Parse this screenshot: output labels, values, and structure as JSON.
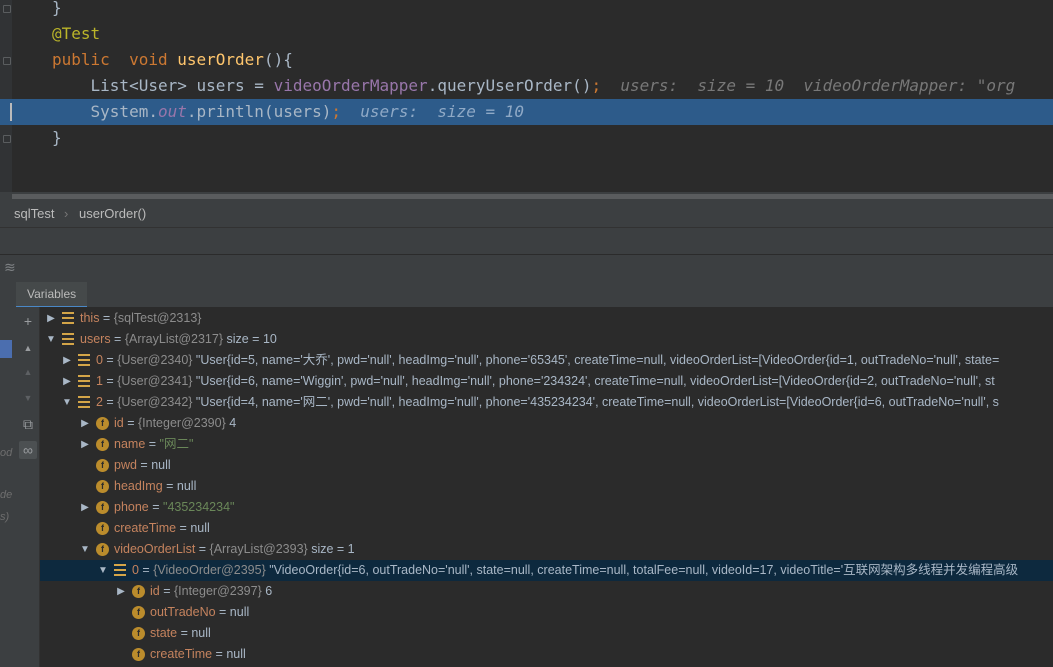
{
  "editor": {
    "lines": [
      {
        "tokens": [
          {
            "t": "}",
            "c": ""
          }
        ]
      },
      {
        "tokens": [
          {
            "t": "@Test",
            "c": "ann"
          }
        ]
      },
      {
        "tokens": [
          {
            "t": "public",
            "c": "k"
          },
          {
            "t": "  ",
            "c": ""
          },
          {
            "t": "void",
            "c": "k"
          },
          {
            "t": " ",
            "c": ""
          },
          {
            "t": "userOrder",
            "c": "fn"
          },
          {
            "t": "(){",
            "c": ""
          }
        ]
      },
      {
        "tokens": [
          {
            "t": "    List<User> users = ",
            "c": ""
          },
          {
            "t": "videoOrderMapper",
            "c": "fld"
          },
          {
            "t": ".queryUserOrder()",
            "c": ""
          },
          {
            "t": ";",
            "c": "k"
          },
          {
            "t": "  users:  size = 10  videoOrderMapper: \"org",
            "c": "hint"
          }
        ]
      },
      {
        "tokens": [
          {
            "t": "    System.",
            "c": ""
          },
          {
            "t": "out",
            "c": "st"
          },
          {
            "t": ".println(users)",
            "c": ""
          },
          {
            "t": ";",
            "c": "k"
          },
          {
            "t": "  users:  size = 10",
            "c": "hint"
          }
        ],
        "highlighted": true
      },
      {
        "tokens": [
          {
            "t": "}",
            "c": ""
          }
        ]
      }
    ]
  },
  "breadcrumb": {
    "class_name": "sqlTest",
    "separator": "›",
    "method_name": "userOrder()"
  },
  "panel": {
    "toolbar_icon": "≋",
    "tab_label": "Variables",
    "left_ghost": [
      "od",
      "de",
      "s)"
    ]
  },
  "toolbar": {
    "add": "+",
    "up": "▲",
    "down": "▼",
    "copy": "⧉",
    "watch": "∞"
  },
  "variables": [
    {
      "depth": 0,
      "arrow": "right",
      "icon": "list",
      "name": "this",
      "type": "{sqlTest@2313}",
      "value": ""
    },
    {
      "depth": 0,
      "arrow": "down",
      "icon": "list",
      "name": "users",
      "type": "{ArrayList@2317}",
      "value": " size = 10"
    },
    {
      "depth": 1,
      "arrow": "right",
      "icon": "list",
      "name": "0",
      "type": "{User@2340}",
      "value": " \"User{id=5, name='大乔', pwd='null', headImg='null', phone='65345', createTime=null, videoOrderList=[VideoOrder{id=1, outTradeNo='null', state="
    },
    {
      "depth": 1,
      "arrow": "right",
      "icon": "list",
      "name": "1",
      "type": "{User@2341}",
      "value": " \"User{id=6, name='Wiggin', pwd='null', headImg='null', phone='234324', createTime=null, videoOrderList=[VideoOrder{id=2, outTradeNo='null', st"
    },
    {
      "depth": 1,
      "arrow": "down",
      "icon": "list",
      "name": "2",
      "type": "{User@2342}",
      "value": " \"User{id=4, name='网二', pwd='null', headImg='null', phone='435234234', createTime=null, videoOrderList=[VideoOrder{id=6, outTradeNo='null', s"
    },
    {
      "depth": 2,
      "arrow": "right",
      "icon": "f",
      "name": "id",
      "type": "{Integer@2390}",
      "value": " 4"
    },
    {
      "depth": 2,
      "arrow": "right",
      "icon": "f",
      "name": "name",
      "type": "",
      "value": "",
      "str": "\"网二\""
    },
    {
      "depth": 2,
      "arrow": "",
      "icon": "f",
      "name": "pwd",
      "type": "",
      "value": "null"
    },
    {
      "depth": 2,
      "arrow": "",
      "icon": "f",
      "name": "headImg",
      "type": "",
      "value": "null"
    },
    {
      "depth": 2,
      "arrow": "right",
      "icon": "f",
      "name": "phone",
      "type": "",
      "value": "",
      "str": "\"435234234\""
    },
    {
      "depth": 2,
      "arrow": "",
      "icon": "f",
      "name": "createTime",
      "type": "",
      "value": "null"
    },
    {
      "depth": 2,
      "arrow": "down",
      "icon": "f",
      "name": "videoOrderList",
      "type": "{ArrayList@2393}",
      "value": " size = 1"
    },
    {
      "depth": 3,
      "arrow": "down",
      "icon": "list",
      "name": "0",
      "type": "{VideoOrder@2395}",
      "value": " \"VideoOrder{id=6, outTradeNo='null', state=null, createTime=null, totalFee=null, videoId=17, videoTitle='互联网架构多线程并发编程高级",
      "selected": true
    },
    {
      "depth": 4,
      "arrow": "right",
      "icon": "f",
      "name": "id",
      "type": "{Integer@2397}",
      "value": " 6"
    },
    {
      "depth": 4,
      "arrow": "",
      "icon": "f",
      "name": "outTradeNo",
      "type": "",
      "value": "null"
    },
    {
      "depth": 4,
      "arrow": "",
      "icon": "f",
      "name": "state",
      "type": "",
      "value": "null"
    },
    {
      "depth": 4,
      "arrow": "",
      "icon": "f",
      "name": "createTime",
      "type": "",
      "value": "null"
    }
  ]
}
